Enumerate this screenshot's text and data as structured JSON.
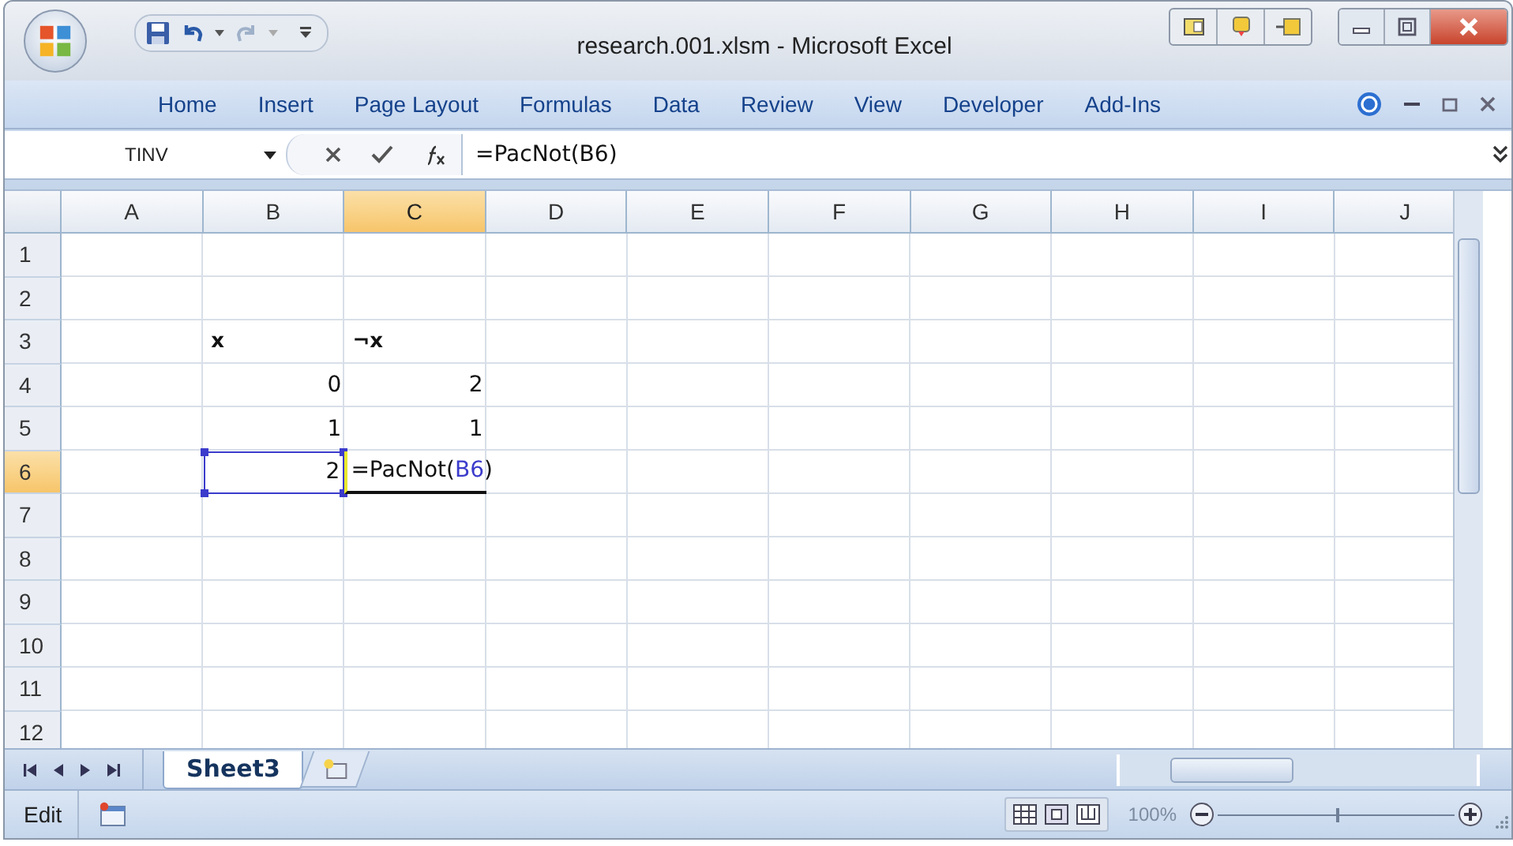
{
  "window": {
    "title": "research.001.xlsm - Microsoft Excel"
  },
  "ribbon_tabs": [
    {
      "label": "Home",
      "selected": false
    },
    {
      "label": "Insert",
      "selected": false
    },
    {
      "label": "Page Layout",
      "selected": false
    },
    {
      "label": "Formulas",
      "selected": false
    },
    {
      "label": "Data",
      "selected": false
    },
    {
      "label": "Review",
      "selected": false
    },
    {
      "label": "View",
      "selected": false
    },
    {
      "label": "Developer",
      "selected": false
    },
    {
      "label": "Add-Ins",
      "selected": false
    }
  ],
  "name_box": {
    "value": "TINV"
  },
  "formula_bar": {
    "value": "=PacNot(B6)"
  },
  "columns": [
    {
      "label": "A",
      "selected": false
    },
    {
      "label": "B",
      "selected": false
    },
    {
      "label": "C",
      "selected": true
    },
    {
      "label": "D",
      "selected": false
    },
    {
      "label": "E",
      "selected": false
    },
    {
      "label": "F",
      "selected": false
    },
    {
      "label": "G",
      "selected": false
    },
    {
      "label": "H",
      "selected": false
    },
    {
      "label": "I",
      "selected": false
    },
    {
      "label": "J",
      "selected": false
    }
  ],
  "rows": [
    {
      "label": "1",
      "selected": false,
      "cells": []
    },
    {
      "label": "2",
      "selected": false,
      "cells": []
    },
    {
      "label": "3",
      "selected": false,
      "cells": [
        {},
        {
          "value": "x",
          "kind": "text",
          "bold": true
        },
        {
          "value": "¬x",
          "kind": "text",
          "bold": true
        }
      ]
    },
    {
      "label": "4",
      "selected": false,
      "cells": [
        {},
        {
          "value": "0",
          "kind": "number"
        },
        {
          "value": "2",
          "kind": "number"
        }
      ]
    },
    {
      "label": "5",
      "selected": false,
      "cells": [
        {},
        {
          "value": "1",
          "kind": "number"
        },
        {
          "value": "1",
          "kind": "number"
        }
      ]
    },
    {
      "label": "6",
      "selected": true,
      "cells": [
        {},
        {
          "value": "2",
          "kind": "number",
          "referenced": true
        },
        {
          "kind": "editing",
          "parts": [
            {
              "text": "=PacNot("
            },
            {
              "text": "B6",
              "kind": "reference"
            },
            {
              "text": ")"
            }
          ]
        }
      ]
    },
    {
      "label": "7",
      "selected": false,
      "cells": []
    },
    {
      "label": "8",
      "selected": false,
      "cells": []
    },
    {
      "label": "9",
      "selected": false,
      "cells": []
    },
    {
      "label": "10",
      "selected": false,
      "cells": []
    },
    {
      "label": "11",
      "selected": false,
      "cells": []
    },
    {
      "label": "12",
      "selected": false,
      "cells": []
    }
  ],
  "sheet_tabs": [
    {
      "label": "Sheet3",
      "selected": true
    }
  ],
  "status_bar": {
    "mode": "Edit",
    "zoom": "100%",
    "zoom_disabled": true,
    "zoom_slider": {
      "level": 0.5
    }
  }
}
